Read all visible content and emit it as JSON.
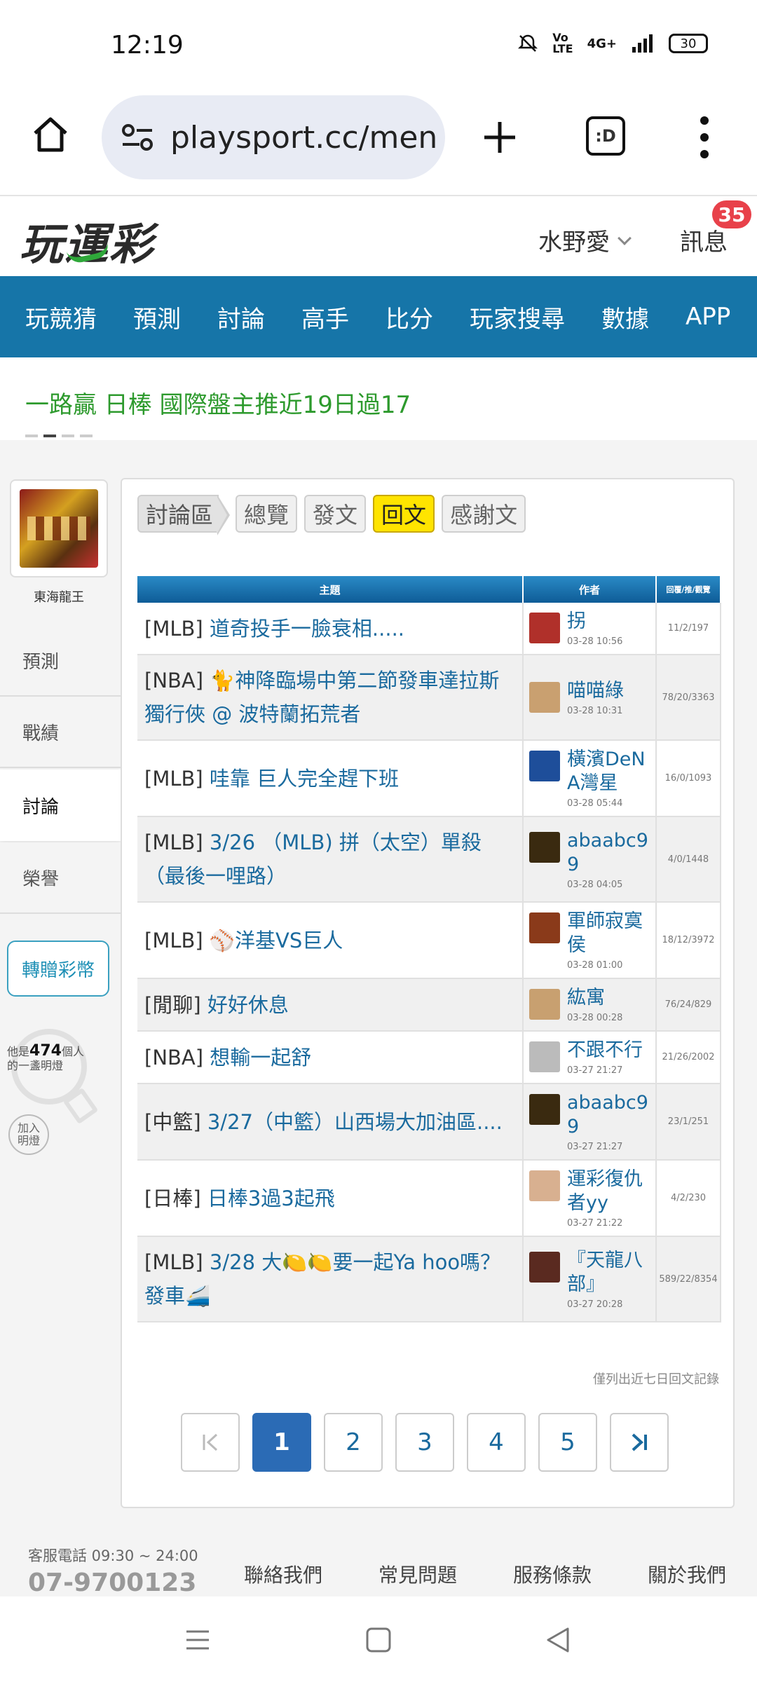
{
  "status": {
    "time": "12:19",
    "battery": "30",
    "network": "4G+"
  },
  "browser": {
    "url": "playsport.cc/men",
    "tabs_label": ":D"
  },
  "header": {
    "logo": "玩運彩",
    "user": "水野愛",
    "messages_label": "訊息",
    "messages_badge": "35"
  },
  "nav": [
    "玩競猜",
    "預測",
    "討論",
    "高手",
    "比分",
    "玩家搜尋",
    "數據",
    "APP"
  ],
  "ticker": {
    "text": "一路贏 日棒 國際盤主推近19日過17"
  },
  "sidebar": {
    "avatar_name": "東海龍王",
    "items": [
      "預測",
      "戰績",
      "討論",
      "榮譽"
    ],
    "gift_button": "轉贈彩幣",
    "bulb_prefix": "他是",
    "bulb_count": "474",
    "bulb_suffix": "個人",
    "bulb_line2": "的一盞明燈",
    "light_button": "加入明燈"
  },
  "tabs": [
    "討論區",
    "總覽",
    "發文",
    "回文",
    "感謝文"
  ],
  "table": {
    "headers": [
      "主題",
      "作者",
      "回覆/推/觀覽"
    ],
    "rows": [
      {
        "cat": "[MLB]",
        "title": "道奇投手一臉衰相.....",
        "author": "拐",
        "time": "03-28 10:56",
        "stats": "11/2/197"
      },
      {
        "cat": "[NBA]",
        "title": "🐈神降臨場中第二節發車達拉斯獨行俠 @ 波特蘭拓荒者",
        "author": "喵喵綠",
        "time": "03-28 10:31",
        "stats": "78/20/3363"
      },
      {
        "cat": "[MLB]",
        "title": "哇靠 巨人完全趕下班",
        "author": "橫濱DeNA灣星",
        "time": "03-28 05:44",
        "stats": "16/0/1093"
      },
      {
        "cat": "[MLB]",
        "title": "3/26 （MLB) 拼（太空）單殺（最後一哩路）",
        "author": "abaabc99",
        "time": "03-28 04:05",
        "stats": "4/0/1448"
      },
      {
        "cat": "[MLB]",
        "title": "⚾洋基VS巨人",
        "author": "軍師寂寞侯",
        "time": "03-28 01:00",
        "stats": "18/12/3972"
      },
      {
        "cat": "[閒聊]",
        "title": "好好休息",
        "author": "紘寓",
        "time": "03-28 00:28",
        "stats": "76/24/829"
      },
      {
        "cat": "[NBA]",
        "title": "想輸一起舒",
        "author": "不跟不行",
        "time": "03-27 21:27",
        "stats": "21/26/2002"
      },
      {
        "cat": "[中籃]",
        "title": "3/27（中籃）山西場大加油區....",
        "author": "abaabc99",
        "time": "03-27 21:27",
        "stats": "23/1/251"
      },
      {
        "cat": "[日棒]",
        "title": "日棒3過3起飛",
        "author": "運彩復仇者yy",
        "time": "03-27 21:22",
        "stats": "4/2/230"
      },
      {
        "cat": "[MLB]",
        "title": "3/28 大🍋🍋要一起Ya hoo嗎？發車🚄",
        "author": "『天龍八部』",
        "time": "03-27 20:28",
        "stats": "589/22/8354"
      }
    ]
  },
  "note": "僅列出近七日回文記錄",
  "pager": {
    "first": "|<",
    "pages": [
      "1",
      "2",
      "3",
      "4",
      "5"
    ],
    "last": ">|"
  },
  "footer": {
    "phone": "客服電話 09:30 ~ 24:00",
    "number": "07-9700123",
    "links": [
      "聯絡我們",
      "常見問題",
      "服務條款",
      "關於我們"
    ]
  },
  "colors": {
    "nav_bg": "#1675a8",
    "ticker": "#2d9a2d",
    "tab_active": "#ffe400",
    "link": "#1a6a9e",
    "pager_current": "#2b6bb5",
    "badge": "#e8414a"
  }
}
